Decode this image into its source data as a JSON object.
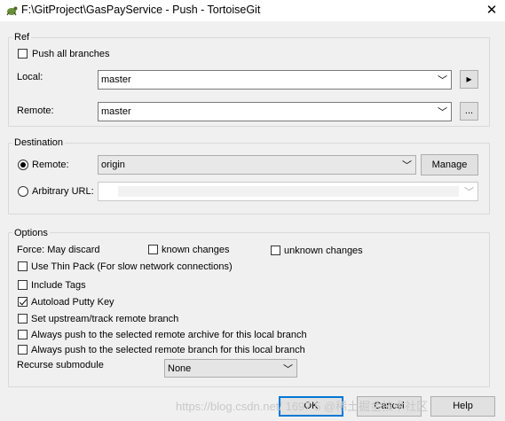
{
  "window": {
    "title": "F:\\GitProject\\GasPayService - Push - TortoiseGit",
    "close_label": "✕"
  },
  "ref": {
    "group_label": "Ref",
    "push_all_branches": {
      "label": "Push all branches",
      "checked": false
    },
    "local": {
      "label": "Local:",
      "value": "master",
      "button_label": "▸"
    },
    "remote": {
      "label": "Remote:",
      "value": "master",
      "button_label": "..."
    }
  },
  "destination": {
    "group_label": "Destination",
    "remote_option": {
      "label": "Remote:",
      "selected": true,
      "value": "origin",
      "manage_label": "Manage"
    },
    "arbitrary_url_option": {
      "label": "Arbitrary URL:",
      "selected": false,
      "value": ""
    }
  },
  "options": {
    "group_label": "Options",
    "force_label": "Force: May discard",
    "known_changes": {
      "label": "known changes",
      "checked": false
    },
    "unknown_changes": {
      "label": "unknown changes",
      "checked": false
    },
    "checkboxes": [
      {
        "label": "Use Thin Pack (For slow network connections)",
        "checked": false
      },
      {
        "label": "Include Tags",
        "checked": false
      },
      {
        "label": "Autoload Putty Key",
        "checked": true
      },
      {
        "label": "Set upstream/track remote branch",
        "checked": false
      },
      {
        "label": "Always push to the selected remote archive for this local branch",
        "checked": false
      },
      {
        "label": "Always push to the selected remote branch for this local branch",
        "checked": false
      }
    ],
    "recurse_submodule": {
      "label": "Recurse submodule",
      "value": "None"
    }
  },
  "buttons": {
    "ok": "OK",
    "cancel": "Cancel",
    "help": "Help"
  },
  "watermark": "https://blog.csdn.net/ 1697 5 @稀土掘金技术社区"
}
